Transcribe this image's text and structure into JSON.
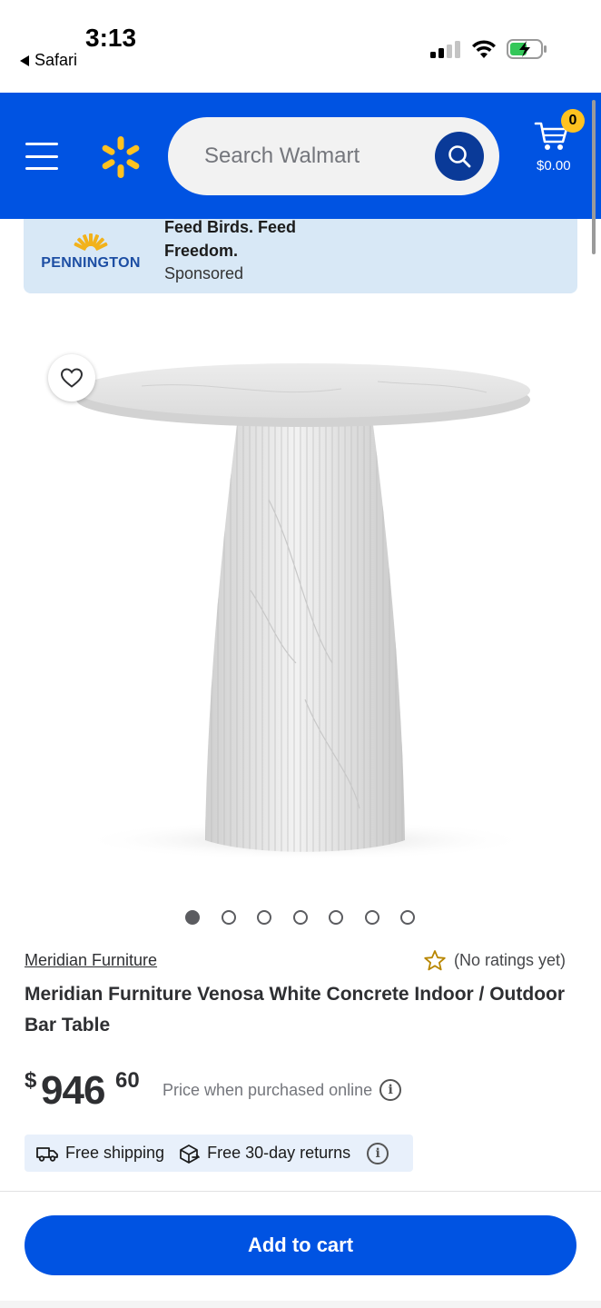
{
  "status_bar": {
    "time": "3:13",
    "back_app": "Safari"
  },
  "header": {
    "search_placeholder": "Search Walmart",
    "cart_count": "0",
    "cart_total": "$0.00",
    "colors": {
      "primary": "#0053e2",
      "spark": "#ffc220",
      "search_button": "#0a3a98"
    }
  },
  "ad": {
    "brand": "PENNINGTON",
    "headline": "Feed Birds. Feed Freedom.",
    "sponsored": "Sponsored"
  },
  "gallery": {
    "image_alt": "White marble-look round pedestal bar table",
    "dot_count": 7,
    "active_dot": 0
  },
  "product": {
    "brand": "Meridian Furniture",
    "rating_text": "(No ratings yet)",
    "title": "Meridian Furniture Venosa White Concrete Indoor / Outdoor Bar Table",
    "price_currency": "$",
    "price_dollars": "946",
    "price_cents": "60",
    "price_note": "Price when purchased online",
    "shipping": "Free shipping",
    "returns": "Free 30-day returns"
  },
  "actions": {
    "add_to_cart": "Add to cart"
  }
}
